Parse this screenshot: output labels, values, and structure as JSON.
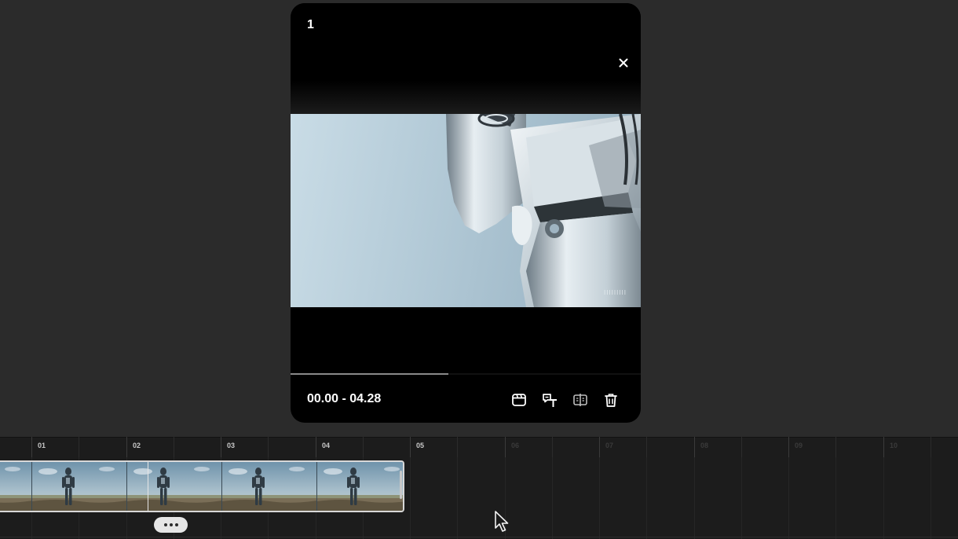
{
  "preview": {
    "clip_number": "1",
    "time_range": "00.00 - 04.28",
    "progress_fraction": 0.45,
    "watermark": "IIIIIIIII",
    "tools": [
      {
        "name": "clip-settings-icon"
      },
      {
        "name": "text-translate-icon"
      },
      {
        "name": "split-compare-icon"
      },
      {
        "name": "trash-icon"
      }
    ]
  },
  "timeline": {
    "ticks": [
      "01",
      "02",
      "03",
      "04",
      "05",
      "06",
      "07",
      "08",
      "09",
      "10"
    ],
    "clip_frames": 5
  },
  "colors": {
    "background": "#2b2b2b",
    "modal": "#000000",
    "timeline": "#1c1c1c",
    "accent_border": "#d8d8d8"
  }
}
